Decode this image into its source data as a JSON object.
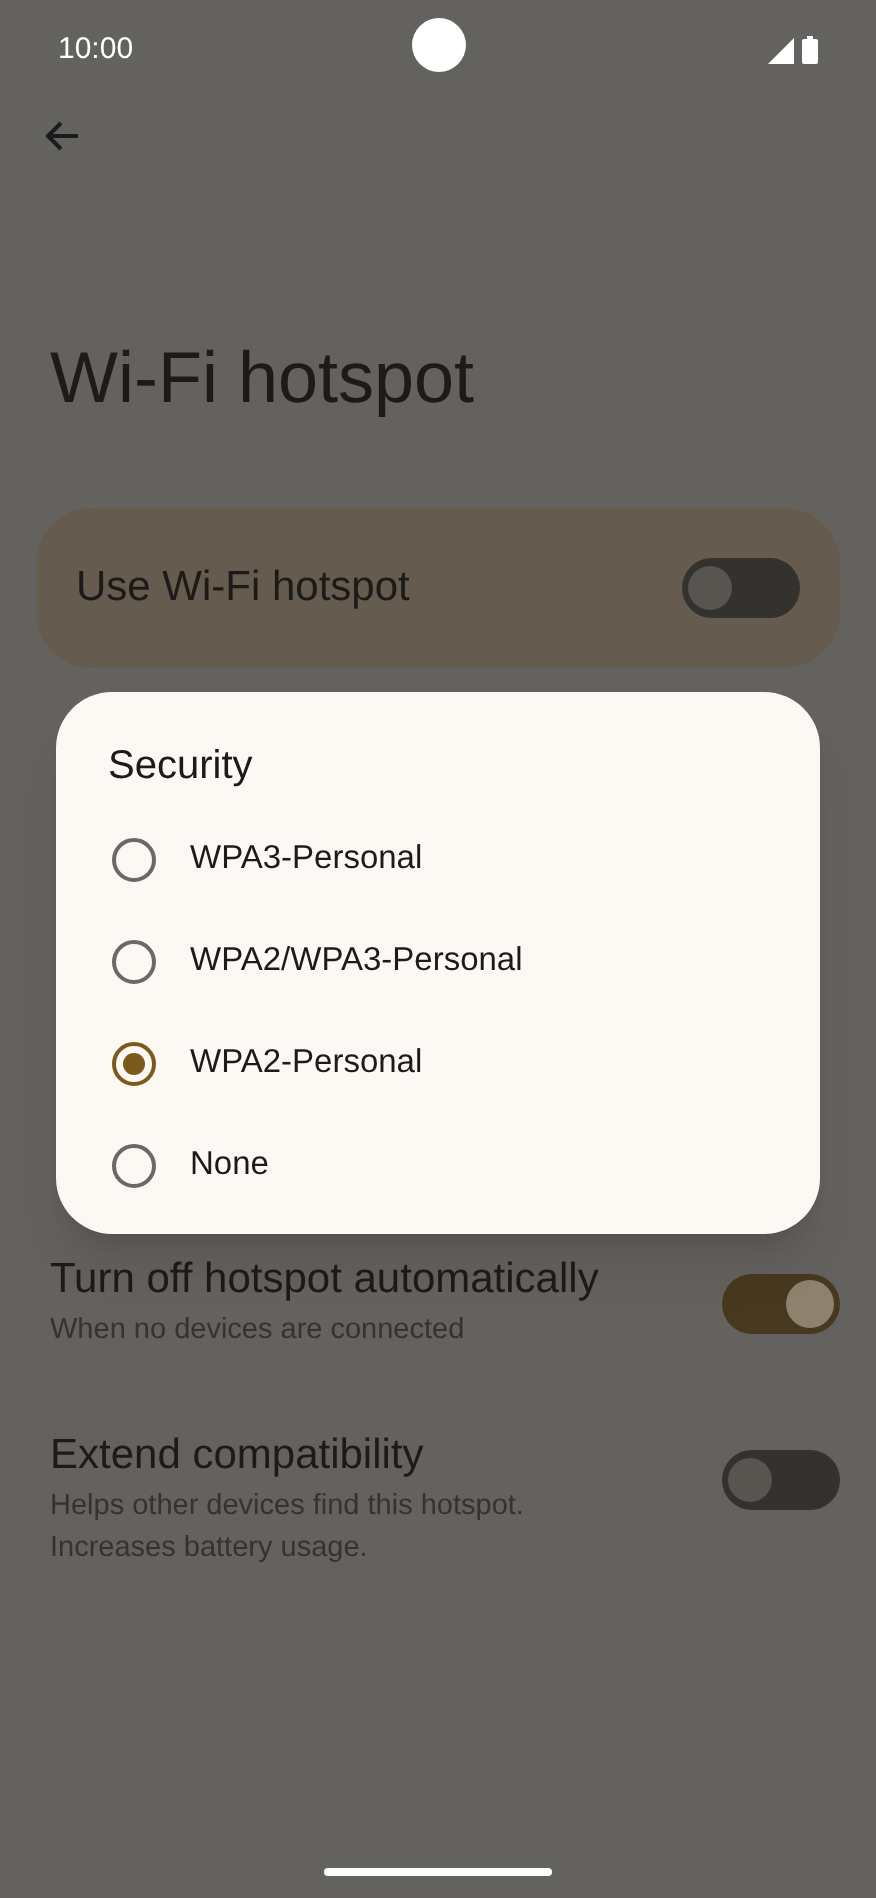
{
  "status_bar": {
    "time": "10:00"
  },
  "title": "Wi-Fi hotspot",
  "main_switch": {
    "label": "Use Wi-Fi hotspot",
    "on": false
  },
  "settings": [
    {
      "title": "Turn off hotspot automatically",
      "subtitle": "When no devices are connected",
      "on": true
    },
    {
      "title": "Extend compatibility",
      "subtitle": "Helps other devices find this hotspot. Increases battery usage.",
      "on": false
    }
  ],
  "dialog": {
    "title": "Security",
    "options": [
      {
        "label": "WPA3-Personal",
        "selected": false
      },
      {
        "label": "WPA2/WPA3-Personal",
        "selected": false
      },
      {
        "label": "WPA2-Personal",
        "selected": true
      },
      {
        "label": "None",
        "selected": false
      }
    ]
  }
}
